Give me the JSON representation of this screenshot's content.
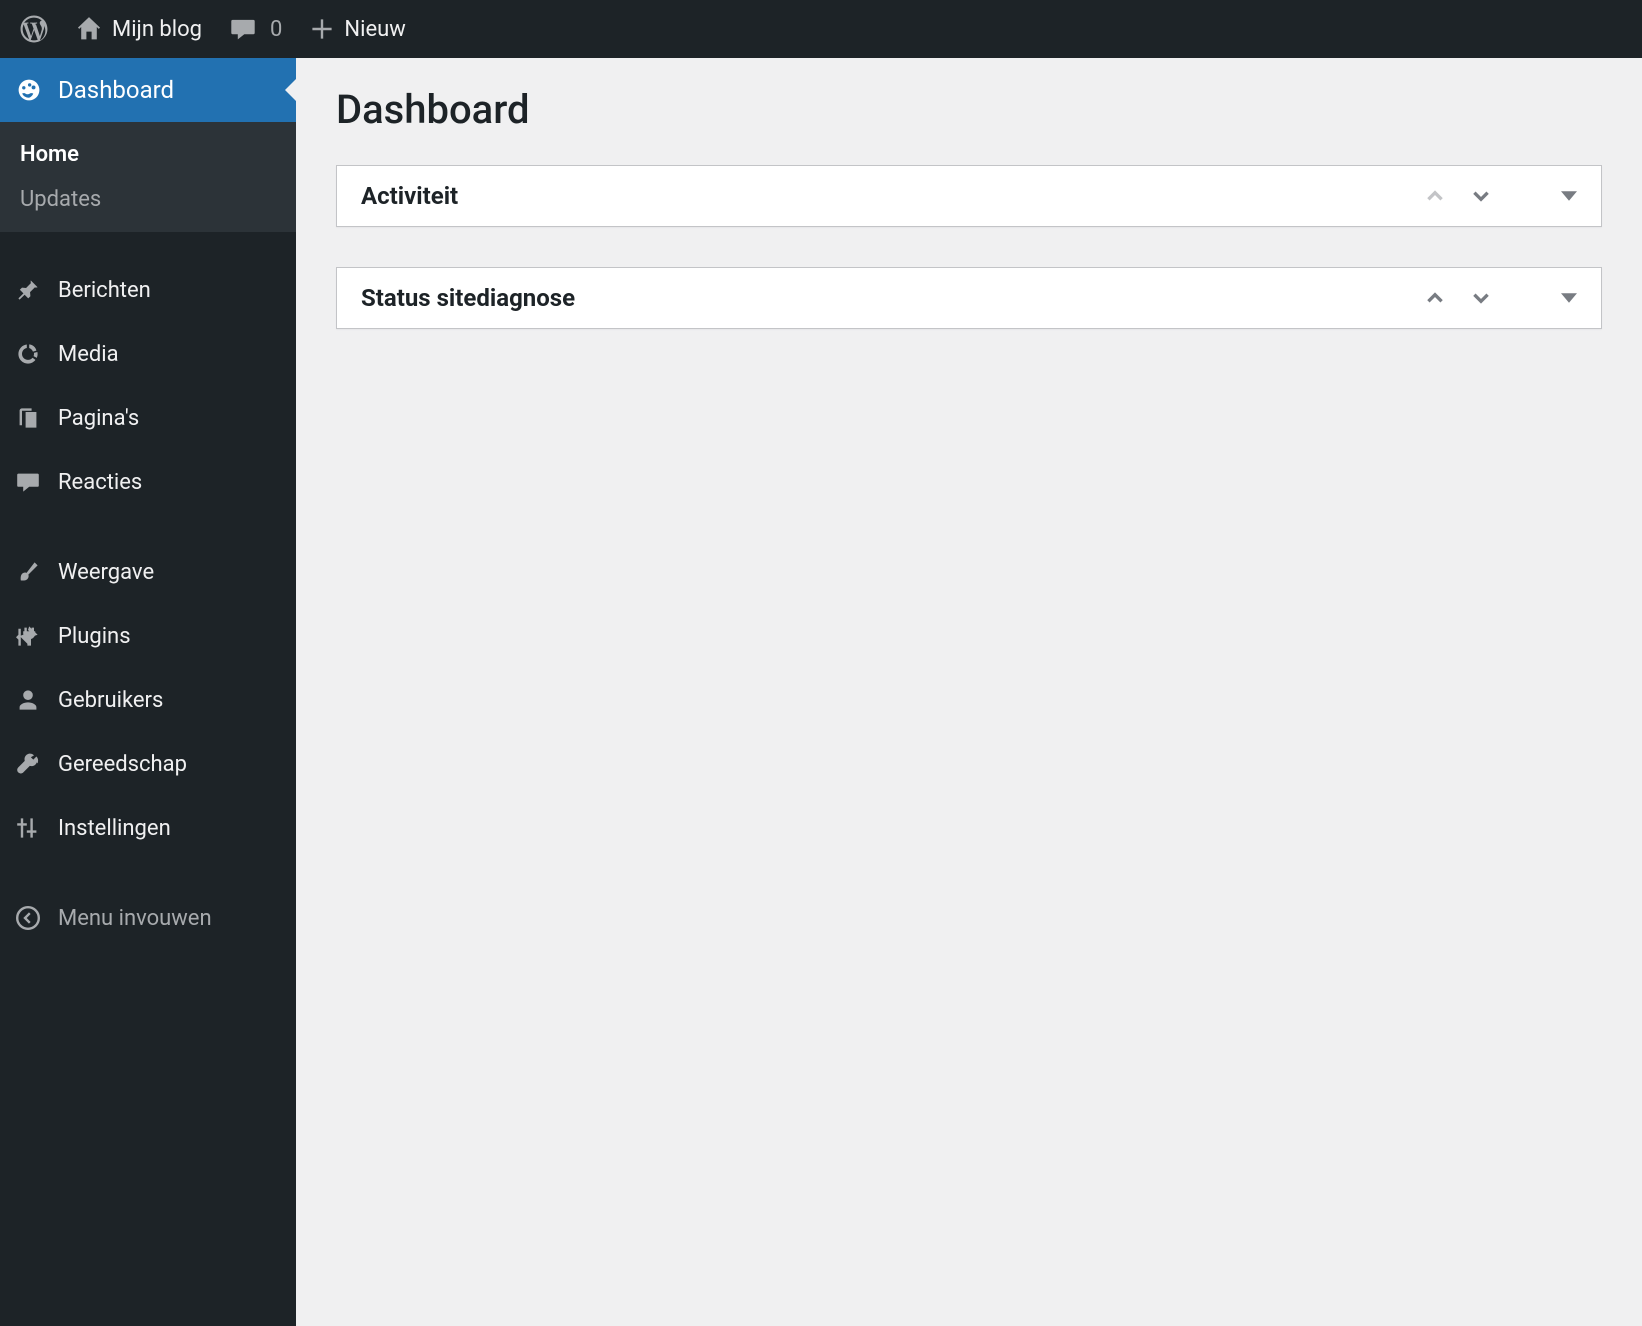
{
  "adminbar": {
    "site_name": "Mijn blog",
    "comments_count": "0",
    "new_label": "Nieuw"
  },
  "sidebar": {
    "dashboard": {
      "label": "Dashboard"
    },
    "dashboard_sub": {
      "home": "Home",
      "updates": "Updates"
    },
    "posts": "Berichten",
    "media": "Media",
    "pages": "Pagina's",
    "comments": "Reacties",
    "appearance": "Weergave",
    "plugins": "Plugins",
    "users": "Gebruikers",
    "tools": "Gereedschap",
    "settings": "Instellingen",
    "collapse": "Menu invouwen"
  },
  "page": {
    "title": "Dashboard",
    "boxes": [
      {
        "title": "Activiteit",
        "up_disabled": true
      },
      {
        "title": "Status sitediagnose",
        "up_disabled": false
      }
    ]
  }
}
